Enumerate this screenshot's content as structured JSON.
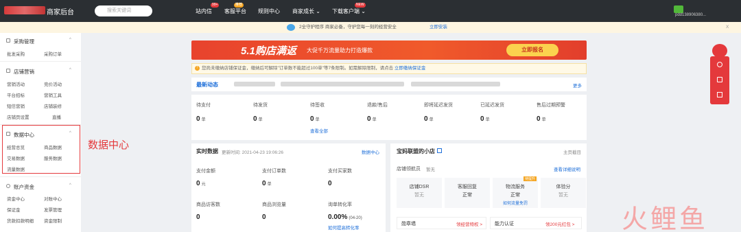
{
  "topbar": {
    "brand": "商家后台",
    "search_placeholder": "搜索关键词",
    "nav": [
      {
        "label": "站内信",
        "badge": "99+"
      },
      {
        "label": "客服平台",
        "badge": "推荐"
      },
      {
        "label": "规则中心",
        "badge": ""
      },
      {
        "label": "商家成长 ⌄",
        "badge": ""
      },
      {
        "label": "下载客户端 ⌄",
        "badge": "NEW"
      }
    ],
    "user_id": "pdd138906380..."
  },
  "announcement": {
    "text": "2全守护程序  商家必备，守护您每一刻的经营安全",
    "link": "立即安装",
    "close": "X"
  },
  "sidebar": {
    "groups": [
      {
        "title": "采购管理",
        "items": [
          "批发采购",
          "采购订单"
        ]
      },
      {
        "title": "店铺营销",
        "items": [
          "营销活动",
          "竞价活动",
          "平台招标",
          "营销工具",
          "短信营销",
          "店铺装修",
          "店铺页设置",
          "直播"
        ]
      },
      {
        "title": "数据中心",
        "items": [
          "经营总览",
          "商品数据",
          "交易数据",
          "服务数据",
          "流量数据"
        ]
      },
      {
        "title": "账户资金",
        "items": [
          "资金中心",
          "对账中心",
          "保证金",
          "发票管理",
          "货款扣款明细",
          "资金限制"
        ]
      }
    ]
  },
  "highlight_label": "数据中心",
  "banner": {
    "title": "5.1购店满返",
    "subtitle": "大促千万流量助力打造爆款",
    "button": "立即报名"
  },
  "notice": {
    "text": "您尚未缴纳店铺保证金，缴纳后可解除\"订单数不能超过100单\"等7条限制。如需解除限制，请点击",
    "link": "立即缴纳保证金"
  },
  "news": {
    "title": "最新动态",
    "more": "更多"
  },
  "orders": {
    "metrics": [
      {
        "label": "待支付",
        "value": "0",
        "unit": "单"
      },
      {
        "label": "待发货",
        "value": "0",
        "unit": "单"
      },
      {
        "label": "待签收",
        "value": "0",
        "unit": "单"
      },
      {
        "label": "退款/售后",
        "value": "0",
        "unit": "单"
      },
      {
        "label": "即将延迟发货",
        "value": "0",
        "unit": "单"
      },
      {
        "label": "已延迟发货",
        "value": "0",
        "unit": "单"
      },
      {
        "label": "售后过期预警",
        "value": "0",
        "unit": "单"
      }
    ],
    "view_all": "查看全部"
  },
  "realtime": {
    "title": "实时数据",
    "updated": "更新时间: 2021-04-23 19:06:26",
    "link": "数据中心",
    "metrics": [
      {
        "label": "支付金额",
        "value": "0",
        "unit": "元"
      },
      {
        "label": "支付订单数",
        "value": "0",
        "unit": "单"
      },
      {
        "label": "支付买家数",
        "value": "0",
        "unit": ""
      },
      {
        "label": "商品访客数",
        "value": "0",
        "unit": ""
      },
      {
        "label": "商品浏览量",
        "value": "0",
        "unit": ""
      },
      {
        "label": "询单转化率",
        "value": "0.00%",
        "unit": "(04-20)"
      }
    ],
    "improve_link": "如何提高转化率"
  },
  "shop": {
    "title": "宝妈联盟的小店",
    "homepage": "主页截目",
    "nav_label": "店铺领航员",
    "nav_value": "暂无",
    "detail_link": "查看详细说明",
    "boxes": [
      {
        "title": "店铺DSR",
        "value": "暂无",
        "link": "",
        "tag": ""
      },
      {
        "title": "客服回复",
        "value": "正常",
        "link": "",
        "tag": ""
      },
      {
        "title": "物流服务",
        "value": "正常",
        "link": "如何流量免罚",
        "tag": "待提升"
      },
      {
        "title": "体验分",
        "value": "暂无",
        "link": "",
        "tag": ""
      }
    ],
    "bottom": [
      {
        "label": "勋章墙",
        "link": "领经营特权 >"
      },
      {
        "label": "能力认证",
        "link": "领200元红包 >"
      }
    ]
  },
  "watermark": "火鲤鱼"
}
